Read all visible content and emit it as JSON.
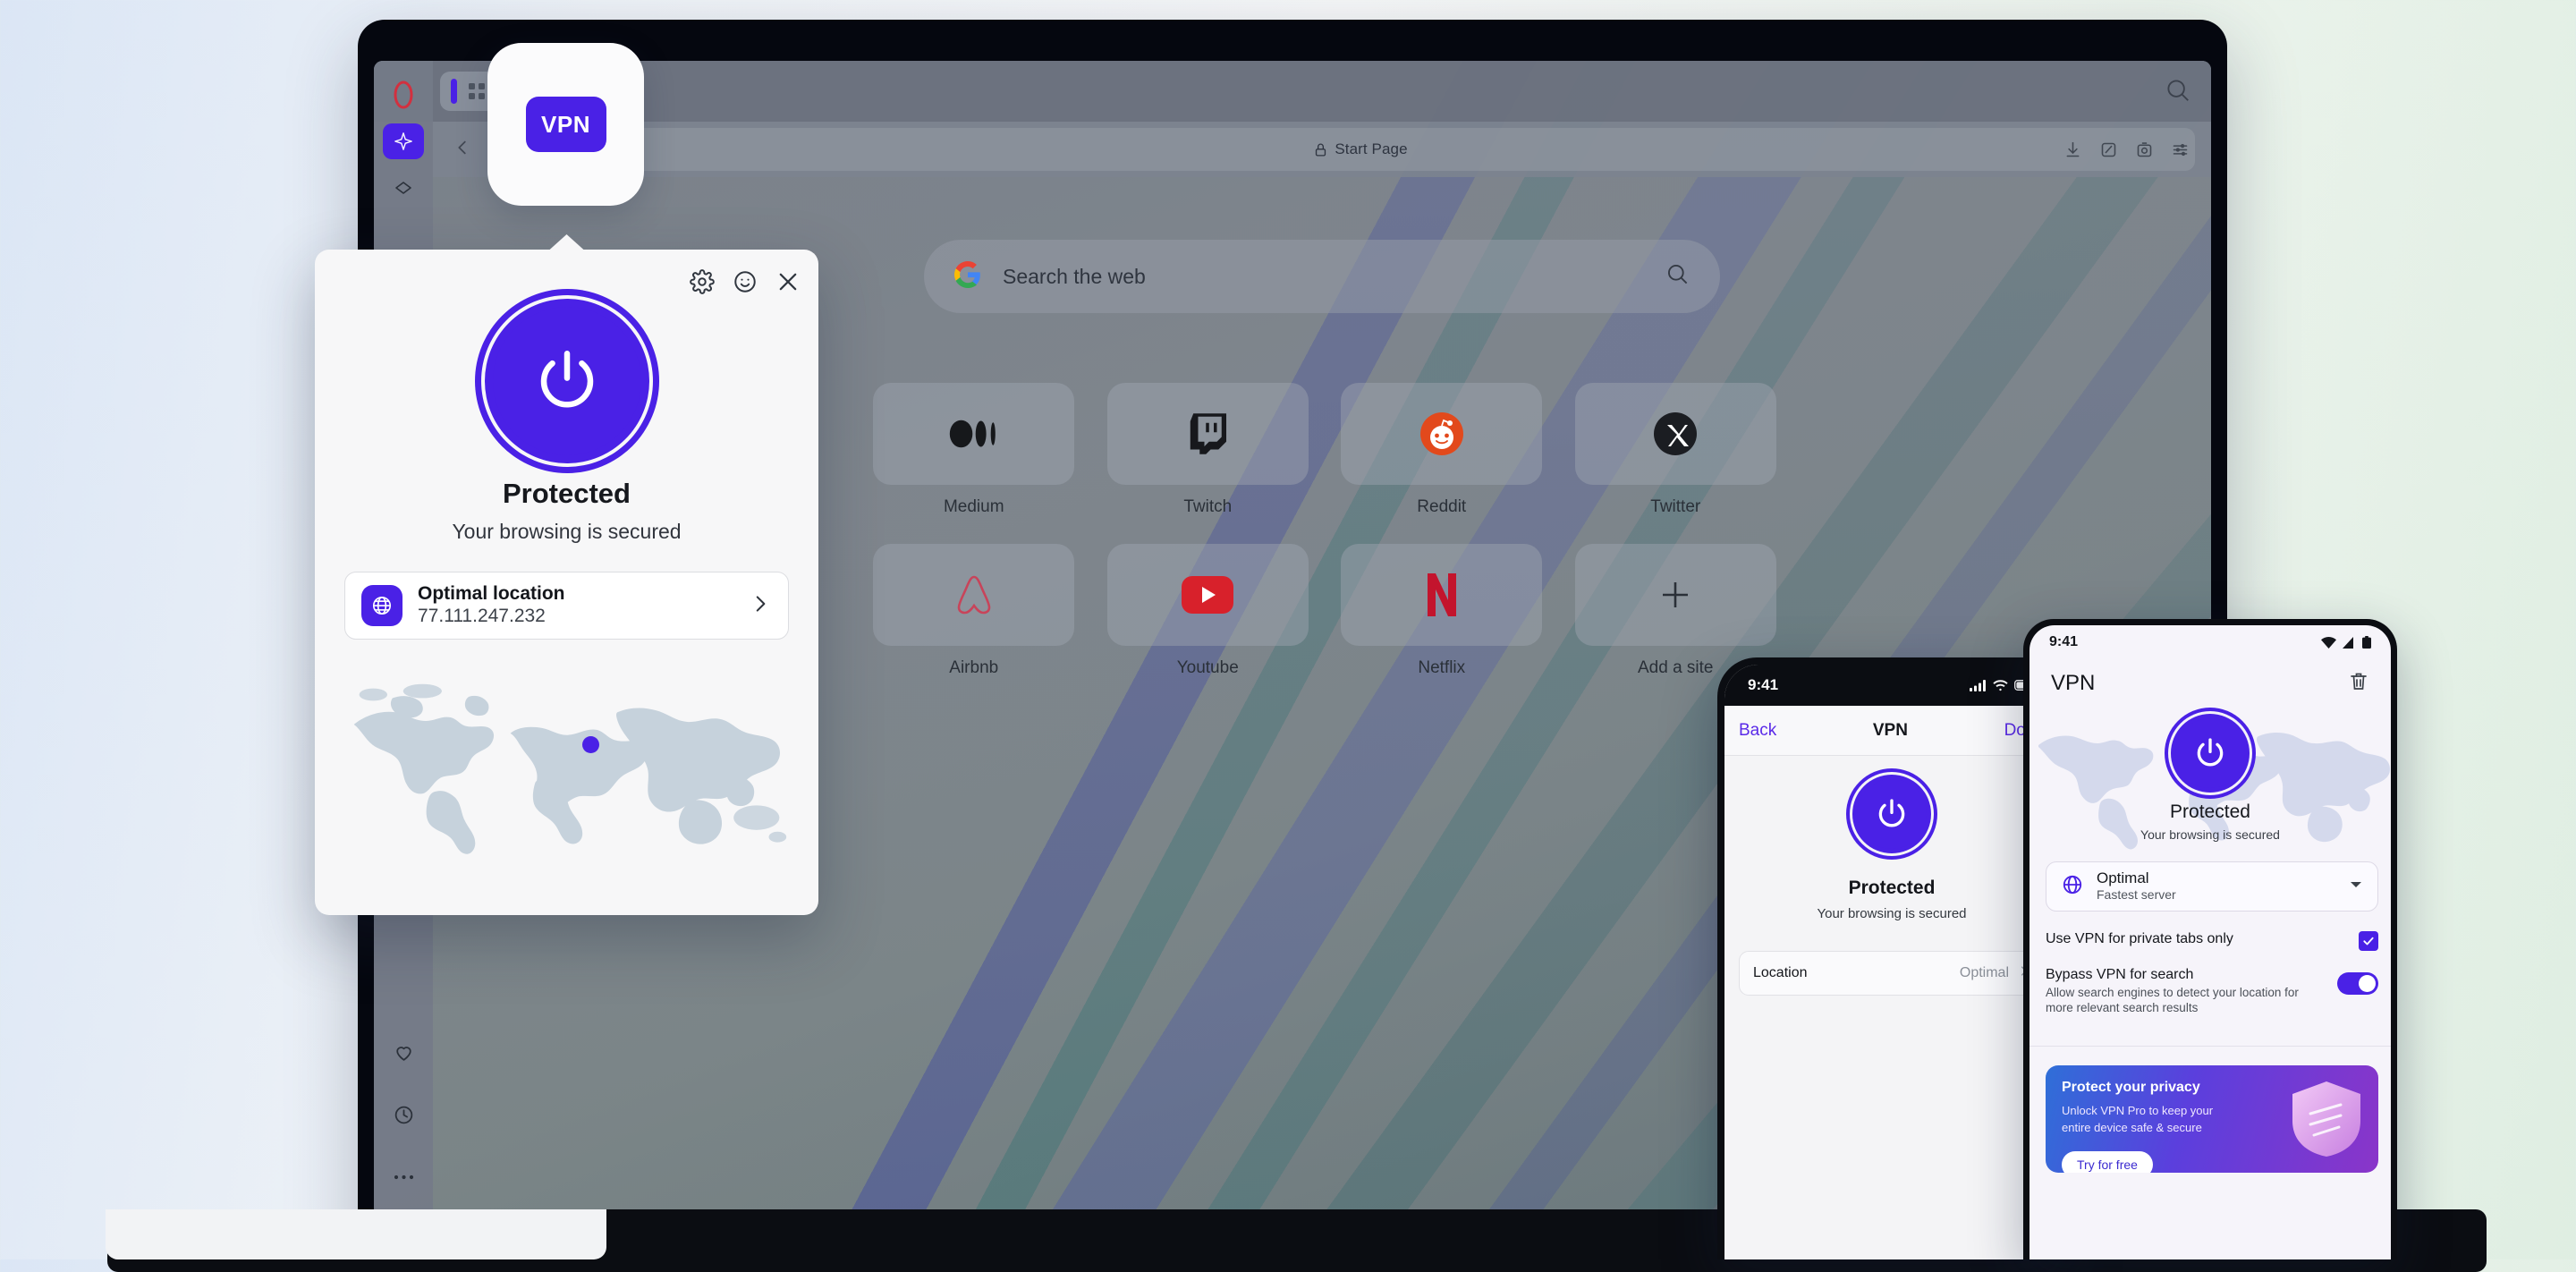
{
  "brand": {
    "accent": "#4A21E6",
    "opera_red": "#E8394A",
    "name": "Opera"
  },
  "browser": {
    "vpn_badge_label": "VPN",
    "tab_new_label": "+",
    "address": {
      "text": "Start Page",
      "lock_icon": "lock-icon"
    },
    "toolbar_icons": [
      "downloads-icon",
      "extensions-icon",
      "snapshot-icon",
      "easy-setup-icon"
    ],
    "top_search_icon": "search-icon",
    "sidebar": {
      "items": [
        {
          "name": "opera-logo",
          "label": "Opera"
        },
        {
          "name": "aria-icon",
          "label": "Aria"
        },
        {
          "name": "diamond-icon",
          "label": "Pinboards"
        }
      ],
      "bottom_items": [
        {
          "name": "heart-icon",
          "label": "Bookmarks"
        },
        {
          "name": "clock-icon",
          "label": "History"
        },
        {
          "name": "more-icon",
          "label": "More"
        }
      ]
    },
    "start_page": {
      "search": {
        "placeholder": "Search the web",
        "engine_icon": "google-icon",
        "submit_icon": "search-icon"
      },
      "speed_dials": [
        {
          "label": "Medium",
          "icon": "medium-icon"
        },
        {
          "label": "Twitch",
          "icon": "twitch-icon"
        },
        {
          "label": "Reddit",
          "icon": "reddit-icon"
        },
        {
          "label": "Twitter",
          "icon": "twitter-x-icon"
        },
        {
          "label": "Airbnb",
          "icon": "airbnb-icon"
        },
        {
          "label": "Youtube",
          "icon": "youtube-icon"
        },
        {
          "label": "Netflix",
          "icon": "netflix-icon"
        },
        {
          "label": "Add a site",
          "icon": "plus-icon"
        }
      ]
    }
  },
  "vpn_popup": {
    "header_icons": [
      {
        "name": "gear-icon",
        "label": "Settings"
      },
      {
        "name": "smiley-icon",
        "label": "Feedback"
      },
      {
        "name": "close-icon",
        "label": "Close"
      }
    ],
    "power_state": "on",
    "status_title": "Protected",
    "status_subtitle": "Your browsing is secured",
    "location": {
      "name": "Optimal location",
      "ip": "77.111.247.232",
      "chevron": "chevron-right-icon",
      "badge_icon": "globe-icon"
    },
    "map": {
      "marker_label": "current-location-marker"
    }
  },
  "iphone": {
    "status": {
      "time": "9:41",
      "icons": [
        "cellular-icon",
        "wifi-icon",
        "battery-icon"
      ]
    },
    "nav": {
      "back": "Back",
      "title": "VPN",
      "done": "Done"
    },
    "status_title": "Protected",
    "status_subtitle": "Your browsing is secured",
    "location_row": {
      "label": "Location",
      "value": "Optimal",
      "chevron": "chevron-right-icon"
    }
  },
  "android": {
    "status": {
      "time": "9:41",
      "icons": [
        "wifi-icon",
        "signal-icon",
        "battery-icon"
      ]
    },
    "header": {
      "title": "VPN",
      "action_icon": "trash-icon"
    },
    "status_title": "Protected",
    "status_subtitle": "Your browsing is secured",
    "server": {
      "name": "Optimal",
      "subtitle": "Fastest server",
      "badge_icon": "globe-icon",
      "chevron": "chevron-down-icon"
    },
    "settings": [
      {
        "title": "Use VPN for private tabs only",
        "desc": "",
        "control": "checkbox",
        "value": "checked"
      },
      {
        "title": "Bypass VPN for search",
        "desc": "Allow search engines to detect your location for more relevant search results",
        "control": "toggle",
        "value": "on"
      }
    ],
    "promo": {
      "title": "Protect your privacy",
      "desc": "Unlock VPN Pro to keep your entire device safe & secure",
      "button": "Try for free",
      "art": "shield-icon"
    }
  }
}
